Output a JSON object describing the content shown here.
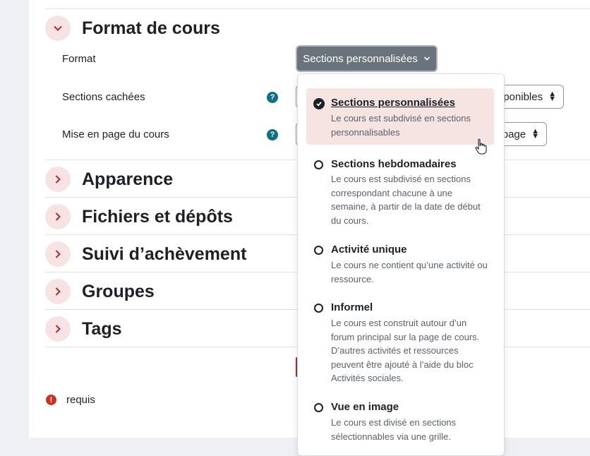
{
  "sections": [
    {
      "title": "Format de cours",
      "expanded": true
    },
    {
      "title": "Apparence",
      "expanded": false
    },
    {
      "title": "Fichiers et dépôts",
      "expanded": false
    },
    {
      "title": "Suivi d’achèvement",
      "expanded": false
    },
    {
      "title": "Groupes",
      "expanded": false
    },
    {
      "title": "Tags",
      "expanded": false
    }
  ],
  "form": {
    "format_label": "Format",
    "format_value": "Sections personnalisées",
    "hidden_sections_label": "Sections cachées",
    "hidden_sections_value_partial": "ponibles",
    "layout_label": "Mise en page du cours",
    "layout_value_partial": "page"
  },
  "dropdown": {
    "options": [
      {
        "name": "Sections personnalisées",
        "desc": "Le cours est subdivisé en sections personnalisables",
        "selected": true
      },
      {
        "name": "Sections hebdomadaires",
        "desc": "Le cours est subdivisé en sections correspondant chacune à une semaine, à partir de la date de début du cours.",
        "selected": false
      },
      {
        "name": "Activité unique",
        "desc": "Le cours ne contient qu’une activité ou ressource.",
        "selected": false
      },
      {
        "name": "Informel",
        "desc": "Le cours est construit autour d’un forum principal sur la page de cours. D’autres activités et ressources peuvent être ajouté à l’aide du bloc Activités sociales.",
        "selected": false
      },
      {
        "name": "Vue en image",
        "desc": "Le cours est divisé en sections sélectionnables via une grille.",
        "selected": false
      }
    ]
  },
  "footer": {
    "required_text": "requis"
  },
  "colors": {
    "accent": "#6a737b",
    "chevron_bg": "#f7e3e3",
    "chevron": "#b02a2a",
    "help": "#0f6e83",
    "required": "#ca3120"
  }
}
